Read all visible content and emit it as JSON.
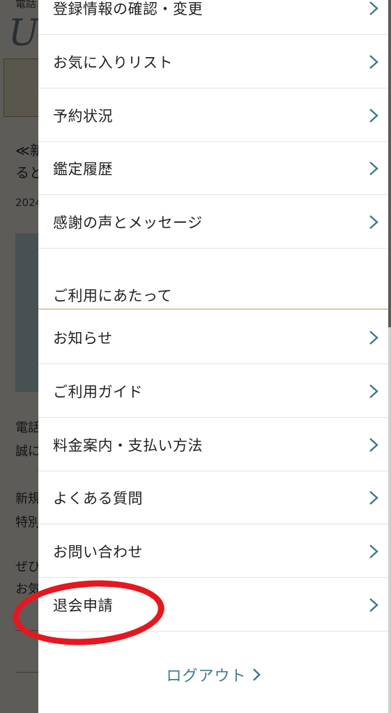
{
  "background": {
    "line1": "電話",
    "line2": "≪新",
    "line3": "ると",
    "line4": "2024",
    "line5": "電話",
    "line6": "誠に",
    "line7": "新規",
    "line8": "特別",
    "line9": "ぜひ",
    "line10": "お気"
  },
  "account_menu": [
    {
      "label": "登録情報の確認・変更"
    },
    {
      "label": "お気に入りリスト"
    },
    {
      "label": "予約状況"
    },
    {
      "label": "鑑定履歴"
    },
    {
      "label": "感謝の声とメッセージ"
    }
  ],
  "section": {
    "heading": "ご利用にあたって"
  },
  "info_menu": [
    {
      "label": "お知らせ"
    },
    {
      "label": "ご利用ガイド"
    },
    {
      "label": "料金案内・支払い方法"
    },
    {
      "label": "よくある質問"
    },
    {
      "label": "お問い合わせ"
    },
    {
      "label": "退会申請"
    }
  ],
  "logout": {
    "label": "ログアウト"
  },
  "colors": {
    "accent": "#3e7a8c",
    "annotation": "#e5171f",
    "divider": "#d9cba8"
  }
}
